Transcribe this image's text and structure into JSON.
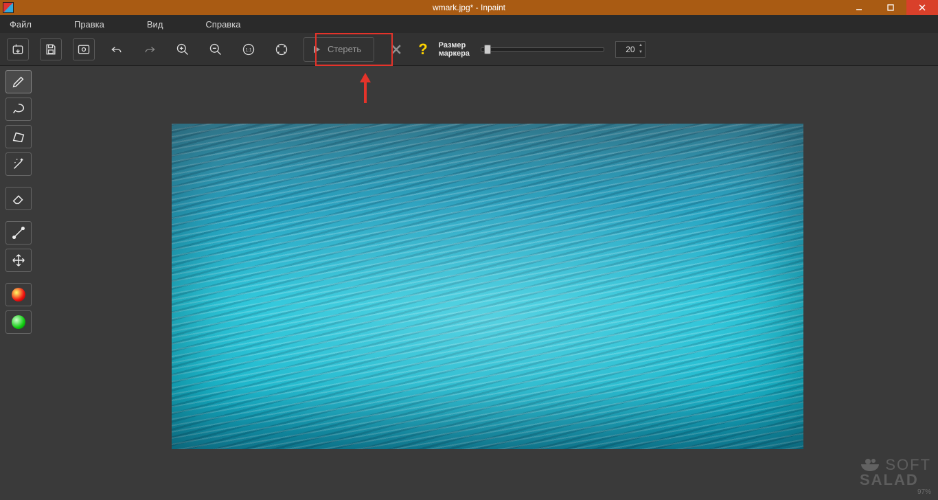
{
  "title": "wmark.jpg* - Inpaint",
  "menu": {
    "file": "Файл",
    "edit": "Правка",
    "view": "Вид",
    "help": "Справка"
  },
  "toolbar": {
    "erase_label": "Стереть",
    "marker_label_l1": "Размер",
    "marker_label_l2": "маркера",
    "marker_value": "20"
  },
  "watermark": {
    "line1": "SOFT",
    "line2": "SALAD",
    "percent": "97%"
  }
}
